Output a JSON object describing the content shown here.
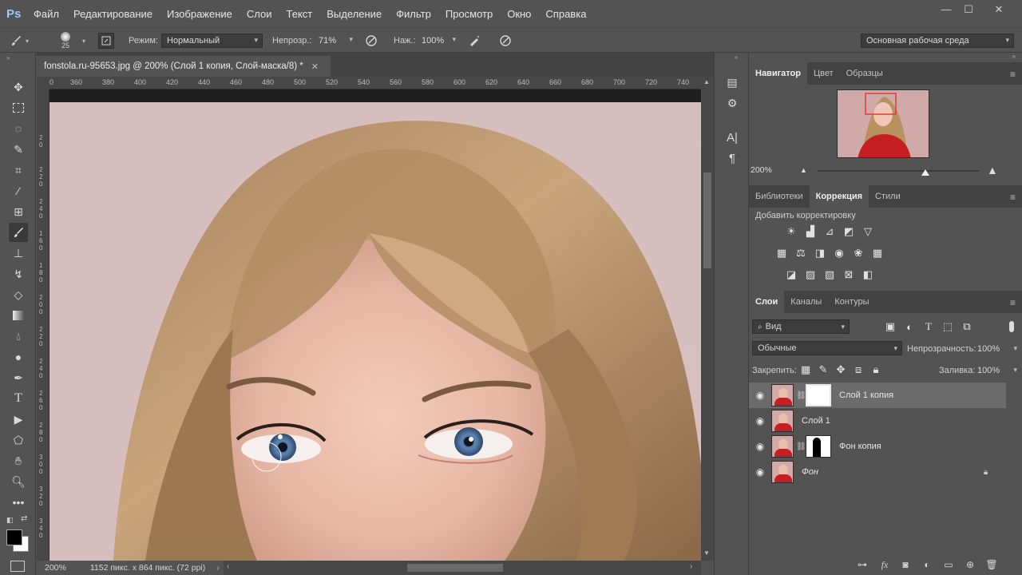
{
  "menu": [
    "Файл",
    "Редактирование",
    "Изображение",
    "Слои",
    "Текст",
    "Выделение",
    "Фильтр",
    "Просмотр",
    "Окно",
    "Справка"
  ],
  "logo": "Ps",
  "options": {
    "brush_size": "25",
    "mode_label": "Режим:",
    "mode_value": "Нормальный",
    "opacity_label": "Непрозр.:",
    "opacity_value": "71%",
    "flow_label": "Наж.:",
    "flow_value": "100%",
    "workspace": "Основная рабочая среда"
  },
  "document": {
    "tab_title": "fonstola.ru-95653.jpg @ 200% (Слой 1 копия, Слой-маска/8) *",
    "zoom": "200%",
    "doc_info": "1152 пикс. x 864 пикс. (72 ppi)",
    "ruler_top": [
      "0",
      "360",
      "380",
      "400",
      "420",
      "440",
      "460",
      "480",
      "500",
      "520",
      "540",
      "560",
      "580",
      "600",
      "620",
      "640",
      "660",
      "680",
      "700",
      "720",
      "740"
    ],
    "ruler_left": [
      "2\n0",
      "2\n2\n0",
      "2\n4\n0",
      "1\n6\n0",
      "1\n8\n0",
      "2\n0\n0",
      "2\n2\n0",
      "2\n4\n0",
      "2\n6\n0",
      "2\n8\n0",
      "3\n0\n0",
      "3\n2\n0",
      "3\n4\n0"
    ]
  },
  "navigator": {
    "tabs": [
      "Навигатор",
      "Цвет",
      "Образцы"
    ],
    "zoom": "200%",
    "zoom_level": 0.67
  },
  "adjustments": {
    "tabs": [
      "Библиотеки",
      "Коррекция",
      "Стили"
    ],
    "title": "Добавить корректировку"
  },
  "layers": {
    "tabs": [
      "Слои",
      "Каналы",
      "Контуры"
    ],
    "filter_value": "Вид",
    "blend_mode": "Обычные",
    "opacity_label": "Непрозрачность:",
    "opacity_value": "100%",
    "lock_label": "Закрепить:",
    "fill_label": "Заливка:",
    "fill_value": "100%",
    "items": [
      {
        "name": "Слой 1 копия",
        "selected": true,
        "mask": "white"
      },
      {
        "name": "Слой 1",
        "selected": false,
        "mask": "none"
      },
      {
        "name": "Фон копия",
        "selected": false,
        "mask": "silhouette"
      },
      {
        "name": "Фон",
        "selected": false,
        "mask": "none",
        "locked": true
      }
    ]
  },
  "colors": {
    "foreground": "#000000",
    "background": "#ffffff",
    "accent_red": "#e23b3b"
  }
}
